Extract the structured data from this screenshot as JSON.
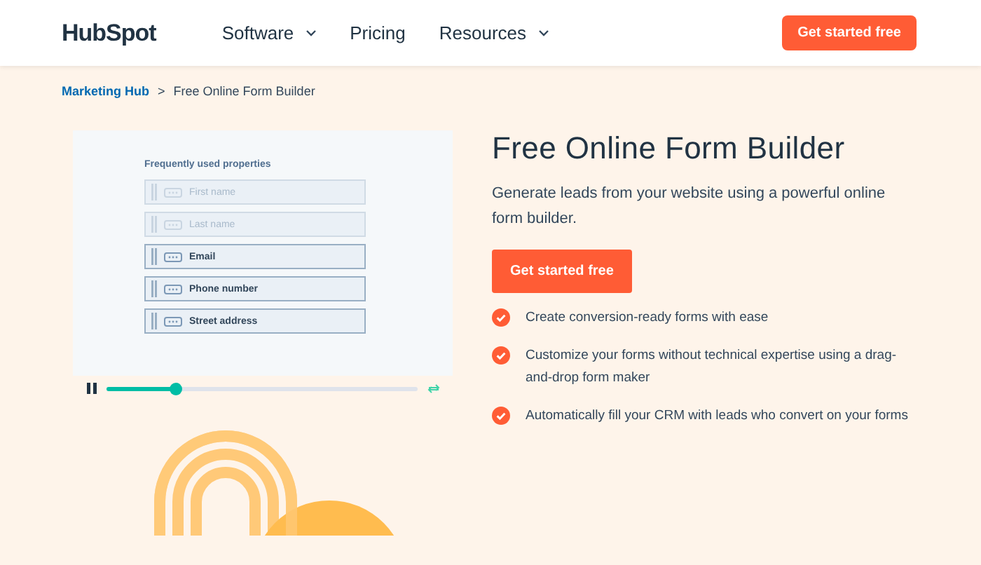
{
  "header": {
    "logo": "HubSpot",
    "nav": [
      {
        "label": "Software",
        "dropdown": true
      },
      {
        "label": "Pricing",
        "dropdown": false
      },
      {
        "label": "Resources",
        "dropdown": true
      }
    ],
    "cta": "Get started free"
  },
  "breadcrumb": {
    "parent": "Marketing Hub",
    "separator": ">",
    "current": "Free Online Form Builder"
  },
  "video": {
    "heading": "Frequently used properties",
    "fields": [
      {
        "label": "First name",
        "dimmed": true
      },
      {
        "label": "Last name",
        "dimmed": true
      },
      {
        "label": "Email",
        "dimmed": false
      },
      {
        "label": "Phone number",
        "dimmed": false
      },
      {
        "label": "Street address",
        "dimmed": false
      }
    ],
    "player": {
      "playing": true,
      "level": 0.22
    }
  },
  "hero": {
    "title": "Free Online Form Builder",
    "description": "Generate leads from your website using a powerful online form builder.",
    "cta": "Get started free",
    "features": [
      "Create conversion-ready forms with ease",
      "Customize your forms without technical expertise using a drag-and-drop form maker",
      "Automatically fill your CRM with leads who convert on your forms"
    ]
  }
}
